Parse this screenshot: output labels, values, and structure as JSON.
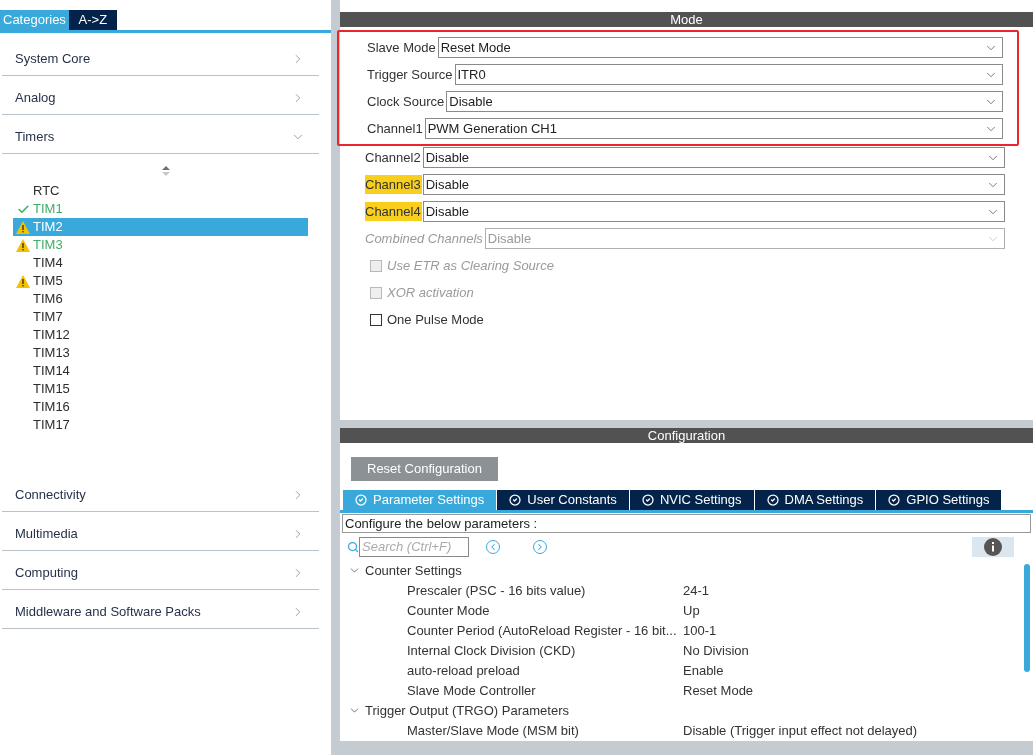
{
  "sidebar": {
    "tabs": [
      {
        "label": "Categories",
        "selected": true
      },
      {
        "label": "A->Z",
        "selected": false
      }
    ],
    "categories_top": [
      {
        "label": "System Core",
        "expanded": false
      },
      {
        "label": "Analog",
        "expanded": false
      },
      {
        "label": "Timers",
        "expanded": true
      }
    ],
    "timers": [
      {
        "label": "RTC",
        "kind": "plain",
        "selected": false
      },
      {
        "label": "TIM1",
        "kind": "ok",
        "selected": false
      },
      {
        "label": "TIM2",
        "kind": "warning",
        "selected": true
      },
      {
        "label": "TIM3",
        "kind": "partial",
        "selected": false
      },
      {
        "label": "TIM4",
        "kind": "plain",
        "selected": false
      },
      {
        "label": "TIM5",
        "kind": "warning",
        "selected": false
      },
      {
        "label": "TIM6",
        "kind": "plain",
        "selected": false
      },
      {
        "label": "TIM7",
        "kind": "plain",
        "selected": false
      },
      {
        "label": "TIM12",
        "kind": "plain",
        "selected": false
      },
      {
        "label": "TIM13",
        "kind": "plain",
        "selected": false
      },
      {
        "label": "TIM14",
        "kind": "plain",
        "selected": false
      },
      {
        "label": "TIM15",
        "kind": "plain",
        "selected": false
      },
      {
        "label": "TIM16",
        "kind": "plain",
        "selected": false
      },
      {
        "label": "TIM17",
        "kind": "plain",
        "selected": false
      }
    ],
    "categories_bottom": [
      {
        "label": "Connectivity",
        "expanded": false
      },
      {
        "label": "Multimedia",
        "expanded": false
      },
      {
        "label": "Computing",
        "expanded": false
      },
      {
        "label": "Middleware and Software Packs",
        "expanded": false
      }
    ]
  },
  "mode": {
    "title": "Mode",
    "highlighted_rows": [
      {
        "kind": "select",
        "label": "Slave Mode",
        "value": "Reset Mode",
        "flagged": false,
        "disabled": false
      },
      {
        "kind": "select",
        "label": "Trigger Source",
        "value": "ITR0",
        "flagged": false,
        "disabled": false
      },
      {
        "kind": "select",
        "label": "Clock Source",
        "value": "Disable",
        "flagged": false,
        "disabled": false
      },
      {
        "kind": "select",
        "label": "Channel1",
        "value": "PWM Generation CH1",
        "flagged": false,
        "disabled": false
      }
    ],
    "rows": [
      {
        "kind": "select",
        "label": "Channel2",
        "value": "Disable",
        "flagged": false,
        "disabled": false
      },
      {
        "kind": "select",
        "label": "Channel3",
        "value": "Disable",
        "flagged": true,
        "disabled": false
      },
      {
        "kind": "select",
        "label": "Channel4",
        "value": "Disable",
        "flagged": true,
        "disabled": false
      },
      {
        "kind": "select",
        "label": "Combined Channels",
        "value": "Disable",
        "flagged": false,
        "disabled": true
      },
      {
        "kind": "checkbox",
        "label": "Use ETR as Clearing Source",
        "checked": false,
        "disabled": true
      },
      {
        "kind": "checkbox",
        "label": "XOR activation",
        "checked": false,
        "disabled": true
      },
      {
        "kind": "checkbox",
        "label": "One Pulse Mode",
        "checked": false,
        "disabled": false
      }
    ]
  },
  "configuration": {
    "title": "Configuration",
    "reset_button": "Reset Configuration",
    "tabs": [
      {
        "label": "Parameter Settings",
        "selected": true
      },
      {
        "label": "User Constants",
        "selected": false
      },
      {
        "label": "NVIC Settings",
        "selected": false
      },
      {
        "label": "DMA Settings",
        "selected": false
      },
      {
        "label": "GPIO Settings",
        "selected": false
      }
    ],
    "hint": "Configure the below parameters :",
    "search": {
      "placeholder": "Search (Ctrl+F)"
    },
    "groups": [
      {
        "label": "Counter Settings",
        "expanded": true,
        "children": [
          {
            "name": "Prescaler (PSC - 16 bits value)",
            "value": "24-1"
          },
          {
            "name": "Counter Mode",
            "value": "Up"
          },
          {
            "name": "Counter Period (AutoReload Register - 16 bit...",
            "value": "100-1"
          },
          {
            "name": "Internal Clock Division (CKD)",
            "value": "No Division"
          },
          {
            "name": "auto-reload preload",
            "value": "Enable"
          },
          {
            "name": "Slave Mode Controller",
            "value": "Reset Mode"
          }
        ]
      },
      {
        "label": "Trigger Output (TRGO) Parameters",
        "expanded": true,
        "children": [
          {
            "name": "Master/Slave Mode (MSM bit)",
            "value": "Disable (Trigger input effect not delayed)"
          }
        ]
      }
    ]
  }
}
